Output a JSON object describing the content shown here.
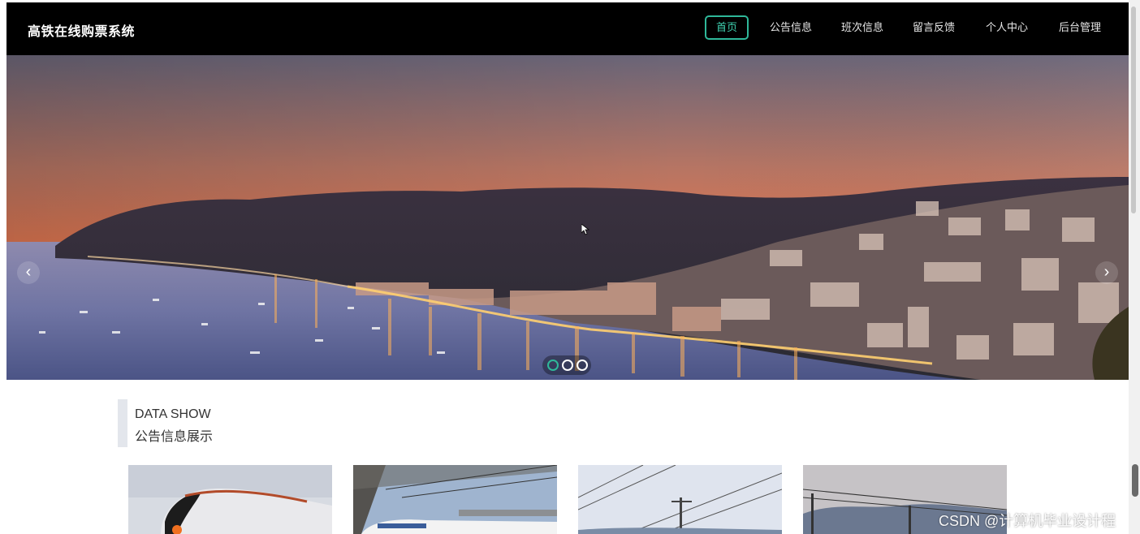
{
  "header": {
    "brand": "高铁在线购票系统",
    "nav": [
      {
        "label": "首页",
        "active": true
      },
      {
        "label": "公告信息",
        "active": false
      },
      {
        "label": "班次信息",
        "active": false
      },
      {
        "label": "留言反馈",
        "active": false
      },
      {
        "label": "个人中心",
        "active": false
      },
      {
        "label": "后台管理",
        "active": false
      }
    ]
  },
  "carousel": {
    "prev_icon": "chevron-left-icon",
    "next_icon": "chevron-right-icon",
    "prev_glyph": "‹",
    "next_glyph": "›",
    "slide_count": 3,
    "active_index": 0
  },
  "section": {
    "title_en": "DATA SHOW",
    "title_cn": "公告信息展示"
  },
  "cards": [
    {
      "image": "train-front-photo"
    },
    {
      "image": "train-station-photo"
    },
    {
      "image": "railway-lines-photo"
    },
    {
      "image": "railway-hills-photo"
    }
  ],
  "watermark": "CSDN @计算机毕业设计程",
  "colors": {
    "header_bg": "#000000",
    "accent": "#2fb89a"
  }
}
